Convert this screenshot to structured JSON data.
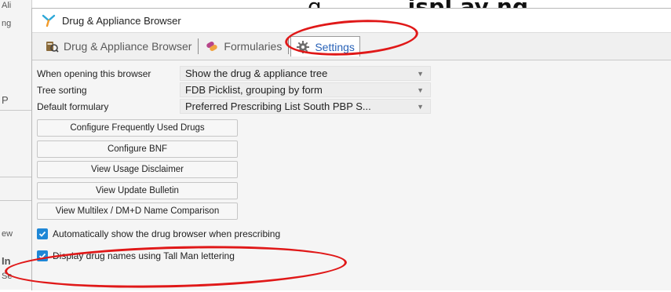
{
  "background": {
    "heading_plain": "g ",
    "heading_bold": "… . . . ispl ay ng",
    "fragments": [
      "Ali",
      "ng",
      "P",
      "ew",
      "In",
      "Se"
    ]
  },
  "window": {
    "title": "Drug & Appliance Browser"
  },
  "tabs": [
    {
      "label": "Drug & Appliance Browser",
      "icon": "drug-browser-icon"
    },
    {
      "label": "Formularies",
      "icon": "formulary-icon"
    },
    {
      "label": "Settings",
      "icon": "gear-icon"
    }
  ],
  "settings": {
    "rows": [
      {
        "label": "When opening this browser",
        "value": "Show the drug & appliance tree"
      },
      {
        "label": "Tree sorting",
        "value": "FDB Picklist, grouping by form"
      },
      {
        "label": "Default formulary",
        "value": "Preferred Prescribing List South PBP S..."
      }
    ],
    "buttons": [
      "Configure Frequently Used Drugs",
      "Configure BNF",
      "View Usage Disclaimer",
      "View Update Bulletin",
      "View Multilex / DM+D Name Comparison"
    ],
    "checkboxes": [
      {
        "label": "Automatically show the drug browser when prescribing",
        "checked": true
      },
      {
        "label": "Display drug names using Tall Man lettering",
        "checked": true
      }
    ]
  },
  "colors": {
    "accent": "#2a63b8",
    "checkbox": "#1f87d6",
    "annotation": "#e01818"
  }
}
